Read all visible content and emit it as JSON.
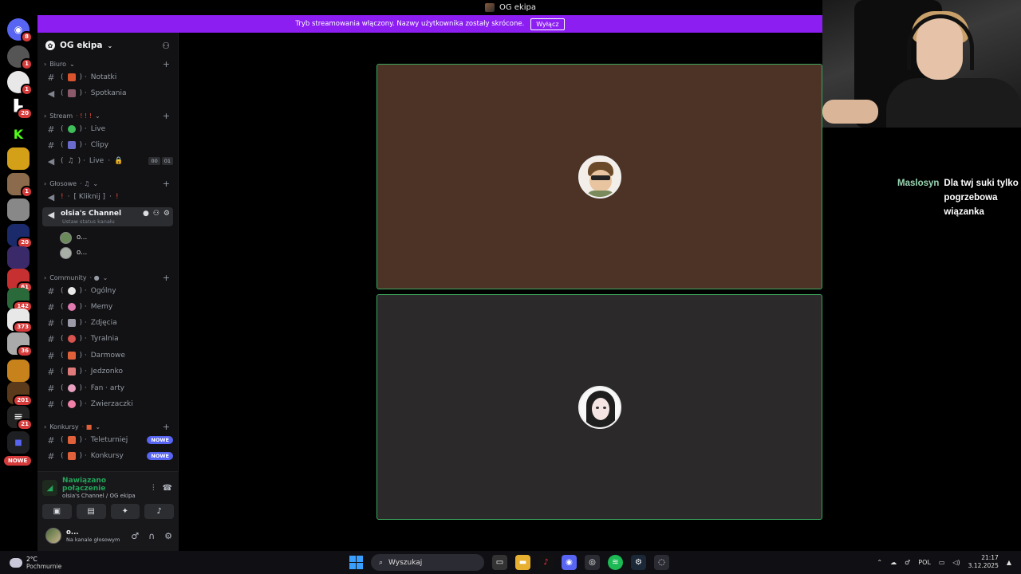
{
  "window": {
    "title": "OG ekipa"
  },
  "banner": {
    "text": "Tryb streamowania włączony. Nazwy użytkownika zostały skrócone.",
    "button": "Wyłącz"
  },
  "rail": {
    "badges": [
      "8",
      "1",
      "1",
      "20",
      "1",
      "61",
      "142",
      "373",
      "36",
      "201",
      "21",
      "20"
    ],
    "nowe": "NOWE"
  },
  "server": {
    "name": "OG ekipa"
  },
  "categories": {
    "biuro": "Biuro",
    "stream": "Stream",
    "glosowe": "Głosowe",
    "community": "Community",
    "konkursy": "Konkursy"
  },
  "channels": {
    "notatki": "Notatki",
    "spotkania": "Spotkania",
    "live1": "Live",
    "clipy": "Clipy",
    "live2": "Live",
    "kliknij": "[ Kliknij ]",
    "olsia": "olsia's Channel",
    "olsia_sub": "Ustaw status kanału",
    "ogolny": "Ogólny",
    "memy": "Memy",
    "zdjecia": "Zdjęcia",
    "tyralnia": "Tyralnia",
    "darmowe": "Darmowe",
    "jedzonko": "Jedzonko",
    "fanarty": "Fan · arty",
    "zwierzaczki": "Zwierzaczki",
    "teleturniej": "Teleturniej",
    "konkursy": "Konkursy"
  },
  "counter": [
    "00",
    "01"
  ],
  "tags": {
    "nowe": "NOWE"
  },
  "members": [
    "o...",
    "o..."
  ],
  "voice": {
    "status": "Nawiązano połączenie",
    "location": "olsia's Channel / OG ekipa"
  },
  "user": {
    "name": "o...",
    "status": "Na kanale głosowym"
  },
  "chat": {
    "nick": "Maslosyn",
    "message": "Dla twj suki tylko pogrzebowa wiązanka"
  },
  "taskbar": {
    "temp": "2°C",
    "weather": "Pochmurnie",
    "search_placeholder": "Wyszukaj",
    "lang": "POL",
    "time": "21:17",
    "date": "3.12.2025"
  },
  "colors": {
    "banner": "#8c1ef2",
    "speaking_border": "#3ba55d",
    "tile1": "#4d3325",
    "tile2": "#2b2929",
    "accent": "#5865f2"
  },
  "icons": [
    "discord-icon",
    "invite-icon",
    "hash-icon",
    "speaker-icon",
    "chat-bubble-icon",
    "gear-icon",
    "mic-icon",
    "headphones-icon",
    "hangup-icon",
    "windows-icon",
    "search-icon"
  ]
}
